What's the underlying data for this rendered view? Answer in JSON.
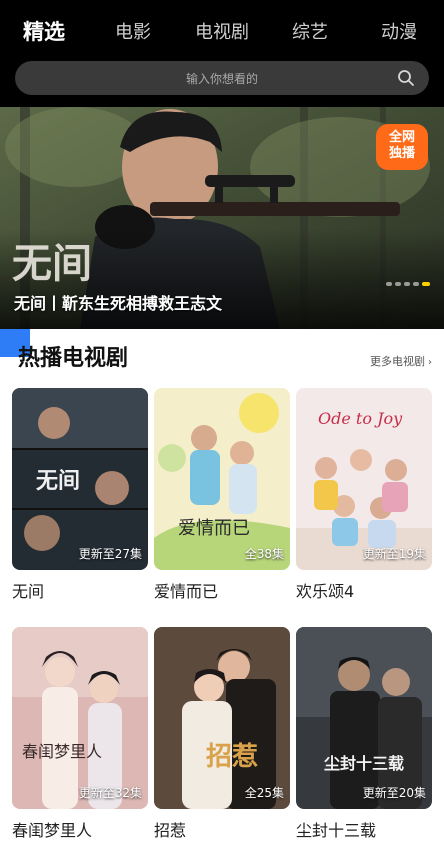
{
  "tabs": [
    {
      "label": "精选",
      "active": true
    },
    {
      "label": "电影",
      "active": false
    },
    {
      "label": "电视剧",
      "active": false
    },
    {
      "label": "综艺",
      "active": false
    },
    {
      "label": "动漫",
      "active": false
    }
  ],
  "search": {
    "placeholder": "输入你想看的",
    "icon": "search-icon"
  },
  "hero": {
    "title": "无间丨靳东生死相搏救王志文",
    "logo_text": "无间",
    "badge_line1": "全网",
    "badge_line2": "独播",
    "carousel_total": 5,
    "carousel_active_index": 4
  },
  "section": {
    "title": "热播电视剧",
    "more_label": "更多电视剧",
    "more_icon": "chevron-right-icon"
  },
  "items": [
    {
      "title": "无间",
      "status": "更新至27集",
      "poster_text": "无间",
      "poster_color": "#2f3a44"
    },
    {
      "title": "爱情而已",
      "status": "全38集",
      "poster_text": "爱情而已",
      "poster_color": "#f2ebc4"
    },
    {
      "title": "欢乐颂4",
      "status": "更新至19集",
      "poster_text": "Ode to Joy",
      "poster_color": "#f1e6e6"
    },
    {
      "title": "春闺梦里人",
      "status": "更新至32集",
      "poster_text": "春闺梦里人",
      "poster_color": "#ddb5b5"
    },
    {
      "title": "招惹",
      "status": "全25集",
      "poster_text": "招惹",
      "poster_color": "#5a4a3e"
    },
    {
      "title": "尘封十三载",
      "status": "更新至20集",
      "poster_text": "尘封十三载",
      "poster_color": "#3b3f44"
    }
  ],
  "colors": {
    "accent": "#2e7cf6",
    "badge": "#ff6a18",
    "active_dot": "#ffd000"
  }
}
